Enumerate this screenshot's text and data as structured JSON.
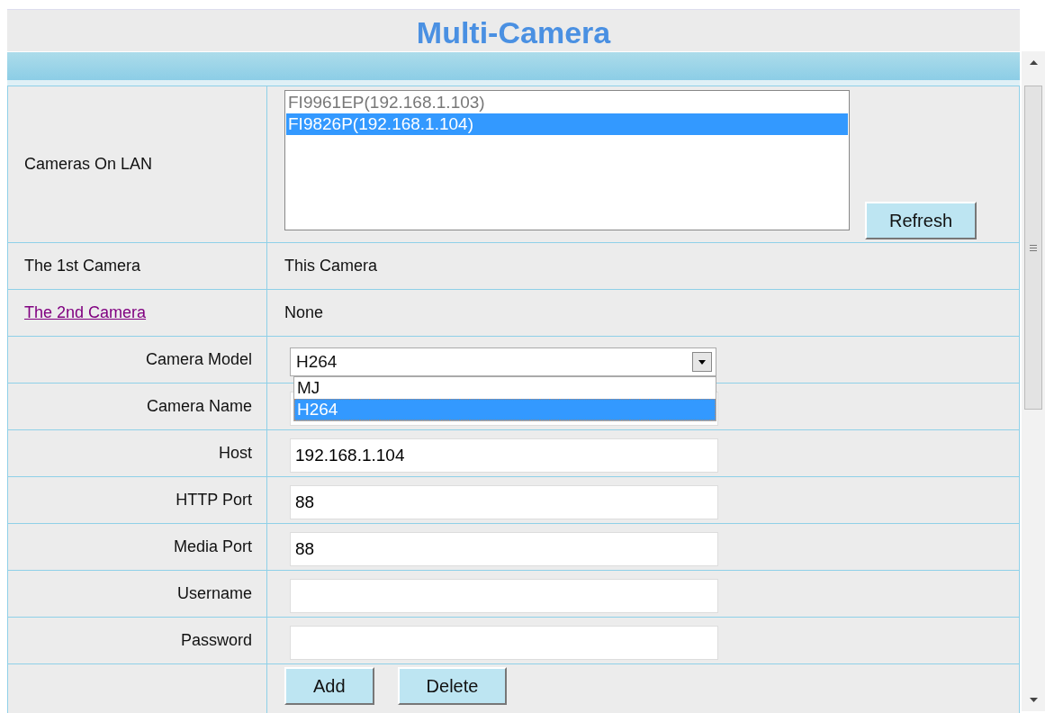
{
  "title": "Multi-Camera",
  "camera_list": {
    "label": "Cameras On LAN",
    "items": [
      {
        "label": "FI9961EP(192.168.1.103)",
        "selected": false
      },
      {
        "label": "FI9826P(192.168.1.104)",
        "selected": true
      }
    ],
    "refresh_button": "Refresh"
  },
  "cameras": [
    {
      "label": "The 1st Camera",
      "kind": "text",
      "value": "This Camera"
    },
    {
      "label": "The 2nd Camera",
      "kind": "link",
      "value": "None"
    }
  ],
  "fields": [
    {
      "label": "Camera Model",
      "kind": "select",
      "value": "H264",
      "expanded": true,
      "options": [
        {
          "label": "MJ",
          "selected": false
        },
        {
          "label": "H264",
          "selected": true
        }
      ]
    },
    {
      "label": "Camera Name",
      "kind": "input"
    },
    {
      "label": "Host",
      "kind": "input",
      "value": "192.168.1.104"
    },
    {
      "label": "HTTP Port",
      "kind": "input",
      "value": "88"
    },
    {
      "label": "Media Port",
      "kind": "input",
      "value": "88"
    },
    {
      "label": "Username",
      "kind": "input"
    },
    {
      "label": "Password",
      "kind": "input"
    }
  ],
  "buttons": [
    "Add",
    "Delete"
  ]
}
